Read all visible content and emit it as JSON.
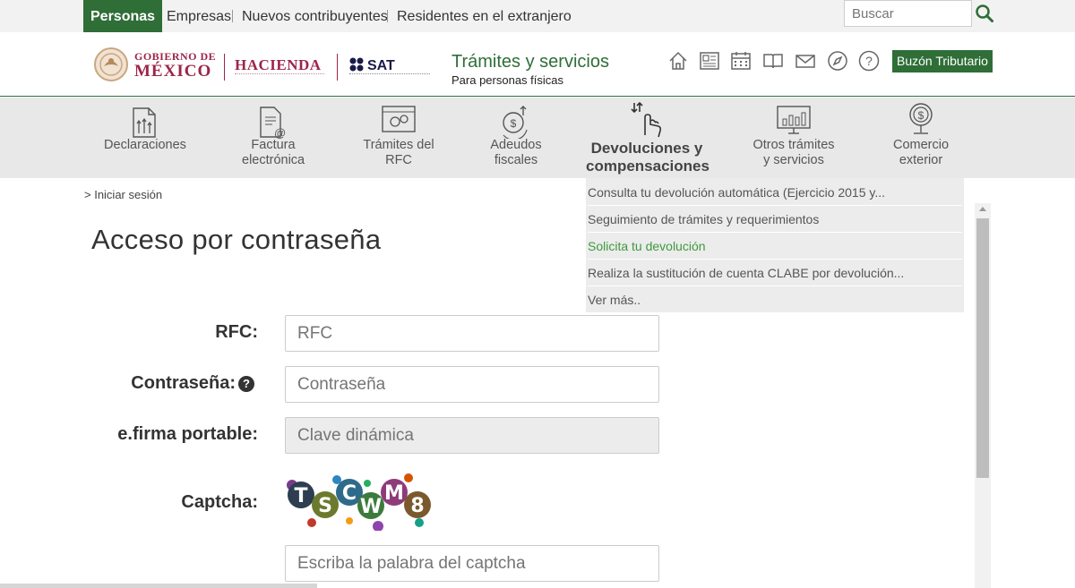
{
  "topbar": {
    "tabs": [
      "Personas",
      "Empresas",
      "Nuevos contribuyentes",
      "Residentes en el extranjero"
    ],
    "search_placeholder": "Buscar"
  },
  "header": {
    "gob_line1": "GOBIERNO DE",
    "gob_line2": "MÉXICO",
    "hacienda": "HACIENDA",
    "sat": "SAT",
    "title": "Trámites y servicios",
    "subtitle": "Para personas físicas",
    "icons": [
      "home-icon",
      "newspaper-icon",
      "calendar-icon",
      "book-icon",
      "mail-icon",
      "compass-icon",
      "help-icon"
    ],
    "buzon_label": "Buzón Tributario"
  },
  "nav": {
    "items": [
      {
        "label": "Declaraciones",
        "icon": "declaraciones-icon"
      },
      {
        "label": "Factura electrónica",
        "icon": "factura-icon"
      },
      {
        "label": "Trámites del RFC",
        "icon": "rfc-icon"
      },
      {
        "label": "Adeudos fiscales",
        "icon": "adeudos-icon"
      },
      {
        "label": "Devoluciones y compensaciones",
        "icon": "devoluciones-icon"
      },
      {
        "label": "Otros trámites y servicios",
        "icon": "otros-icon"
      },
      {
        "label": "Comercio exterior",
        "icon": "comercio-icon"
      }
    ]
  },
  "dropdown": {
    "items": [
      "Consulta tu devolución automática (Ejercicio 2015 y...",
      "Seguimiento de trámites y requerimientos",
      "Solicita tu devolución",
      "Realiza la sustitución de cuenta CLABE por devolución...",
      "Ver más.."
    ]
  },
  "breadcrumb": "> Iniciar sesión",
  "page_title": "Acceso por contraseña",
  "form": {
    "rfc_label": "RFC:",
    "rfc_placeholder": "RFC",
    "password_label": "Contraseña:",
    "password_placeholder": "Contraseña",
    "efirma_label": "e.firma portable:",
    "efirma_placeholder": "Clave dinámica",
    "captcha_label": "Captcha:",
    "captcha_text": "TSCWM8",
    "captcha_placeholder": "Escriba la palabra del captcha"
  },
  "colors": {
    "accent": "#2f6e37",
    "gob": "#9d2449",
    "highlight": "#3d9a3d"
  }
}
